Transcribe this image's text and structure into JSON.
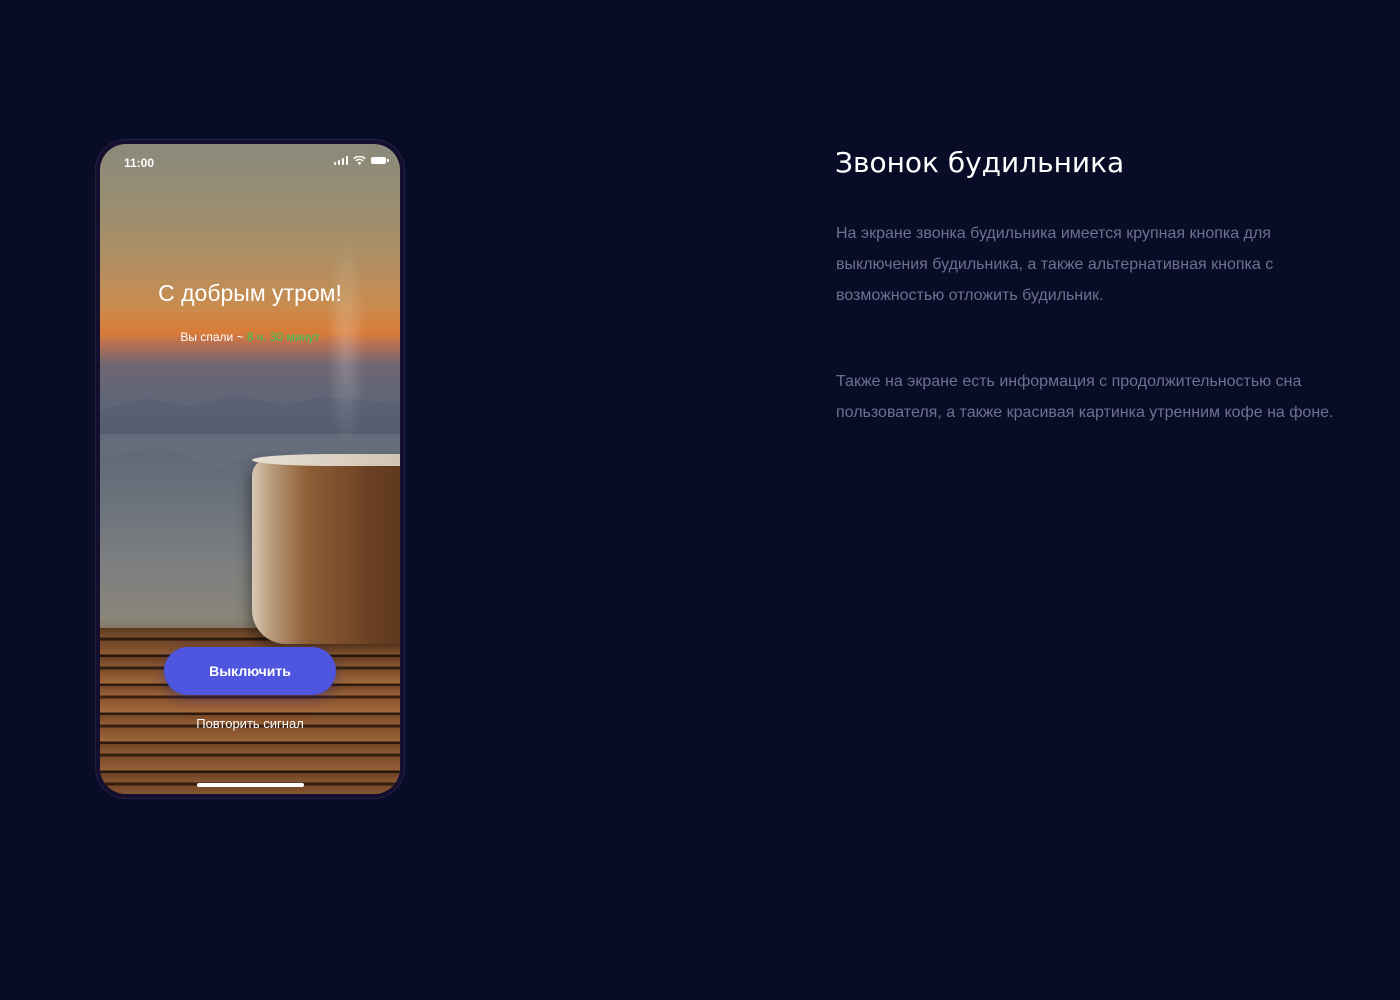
{
  "phone": {
    "status_bar": {
      "time": "11:00"
    },
    "greeting": "С добрым утром!",
    "sleep": {
      "prefix": "Вы спали ~ ",
      "value": "8 ч. 30 минут",
      "value_color": "#3ecb50"
    },
    "dismiss_label": "Выключить",
    "snooze_label": "Повторить сигнал",
    "accent_color": "#4e56e0"
  },
  "info": {
    "title": "Звонок будильника",
    "paragraph_1": "На экране звонка будильника имеется крупная кнопка для выключения будильника, а также альтернативная кнопка с возможностью отложить будильник.",
    "paragraph_2": "Также на экране есть информация с продолжительностью сна пользователя, а также красивая картинка утренним кофе на фоне."
  },
  "colors": {
    "background": "#080c26",
    "text_secondary": "#6e7090"
  }
}
